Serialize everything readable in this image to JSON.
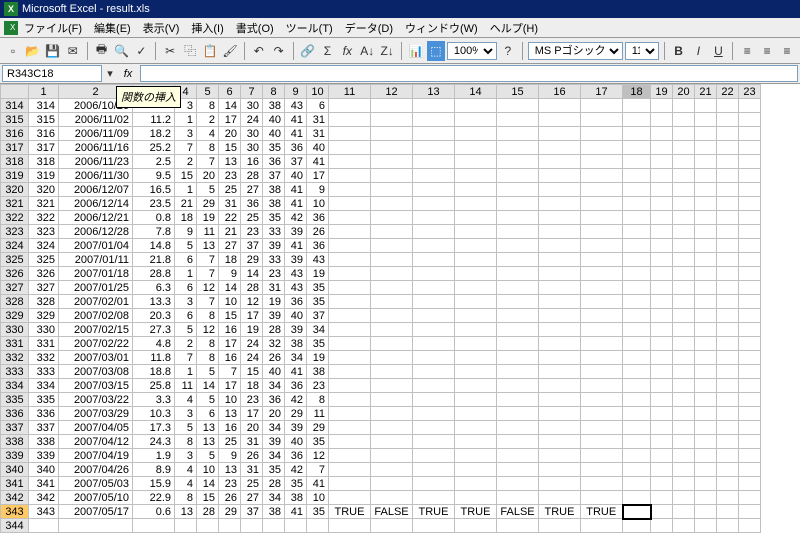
{
  "title": "Microsoft Excel - result.xls",
  "menu": [
    "ファイル(F)",
    "編集(E)",
    "表示(V)",
    "挿入(I)",
    "書式(O)",
    "ツール(T)",
    "データ(D)",
    "ウィンドウ(W)",
    "ヘルプ(H)"
  ],
  "namebox": "R343C18",
  "tooltip": "関数の挿入",
  "zoom": "100%",
  "font": "MS Pゴシック",
  "fontsize": "11",
  "cols": [
    "",
    "1",
    "2",
    "3",
    "4",
    "5",
    "6",
    "7",
    "8",
    "9",
    "10",
    "11",
    "12",
    "13",
    "14",
    "15",
    "16",
    "17",
    "18",
    "19",
    "20",
    "21",
    "22",
    "23"
  ],
  "selcol": "18",
  "selrow": "343",
  "rows": [
    {
      "r": "314",
      "c": [
        "314",
        "2006/10/26",
        "",
        "3",
        "8",
        "14",
        "30",
        "38",
        "43",
        "6",
        "",
        "",
        "",
        "",
        "",
        "",
        "",
        ""
      ]
    },
    {
      "r": "315",
      "c": [
        "315",
        "2006/11/02",
        "11.2",
        "1",
        "2",
        "17",
        "24",
        "40",
        "41",
        "31",
        "",
        "",
        "",
        "",
        "",
        "",
        "",
        ""
      ]
    },
    {
      "r": "316",
      "c": [
        "316",
        "2006/11/09",
        "18.2",
        "3",
        "4",
        "20",
        "30",
        "40",
        "41",
        "31",
        "",
        "",
        "",
        "",
        "",
        "",
        "",
        ""
      ]
    },
    {
      "r": "317",
      "c": [
        "317",
        "2006/11/16",
        "25.2",
        "7",
        "8",
        "15",
        "30",
        "35",
        "36",
        "40",
        "",
        "",
        "",
        "",
        "",
        "",
        "",
        ""
      ]
    },
    {
      "r": "318",
      "c": [
        "318",
        "2006/11/23",
        "2.5",
        "2",
        "7",
        "13",
        "16",
        "36",
        "37",
        "41",
        "",
        "",
        "",
        "",
        "",
        "",
        "",
        ""
      ]
    },
    {
      "r": "319",
      "c": [
        "319",
        "2006/11/30",
        "9.5",
        "15",
        "20",
        "23",
        "28",
        "37",
        "40",
        "17",
        "",
        "",
        "",
        "",
        "",
        "",
        "",
        ""
      ]
    },
    {
      "r": "320",
      "c": [
        "320",
        "2006/12/07",
        "16.5",
        "1",
        "5",
        "25",
        "27",
        "38",
        "41",
        "9",
        "",
        "",
        "",
        "",
        "",
        "",
        "",
        ""
      ]
    },
    {
      "r": "321",
      "c": [
        "321",
        "2006/12/14",
        "23.5",
        "21",
        "29",
        "31",
        "36",
        "38",
        "41",
        "10",
        "",
        "",
        "",
        "",
        "",
        "",
        "",
        ""
      ]
    },
    {
      "r": "322",
      "c": [
        "322",
        "2006/12/21",
        "0.8",
        "18",
        "19",
        "22",
        "25",
        "35",
        "42",
        "36",
        "",
        "",
        "",
        "",
        "",
        "",
        "",
        ""
      ]
    },
    {
      "r": "323",
      "c": [
        "323",
        "2006/12/28",
        "7.8",
        "9",
        "11",
        "21",
        "23",
        "33",
        "39",
        "26",
        "",
        "",
        "",
        "",
        "",
        "",
        "",
        ""
      ]
    },
    {
      "r": "324",
      "c": [
        "324",
        "2007/01/04",
        "14.8",
        "5",
        "13",
        "27",
        "37",
        "39",
        "41",
        "36",
        "",
        "",
        "",
        "",
        "",
        "",
        "",
        ""
      ]
    },
    {
      "r": "325",
      "c": [
        "325",
        "2007/01/11",
        "21.8",
        "6",
        "7",
        "18",
        "29",
        "33",
        "39",
        "43",
        "",
        "",
        "",
        "",
        "",
        "",
        "",
        ""
      ]
    },
    {
      "r": "326",
      "c": [
        "326",
        "2007/01/18",
        "28.8",
        "1",
        "7",
        "9",
        "14",
        "23",
        "43",
        "19",
        "",
        "",
        "",
        "",
        "",
        "",
        "",
        ""
      ]
    },
    {
      "r": "327",
      "c": [
        "327",
        "2007/01/25",
        "6.3",
        "6",
        "12",
        "14",
        "28",
        "31",
        "43",
        "35",
        "",
        "",
        "",
        "",
        "",
        "",
        "",
        ""
      ]
    },
    {
      "r": "328",
      "c": [
        "328",
        "2007/02/01",
        "13.3",
        "3",
        "7",
        "10",
        "12",
        "19",
        "36",
        "35",
        "",
        "",
        "",
        "",
        "",
        "",
        "",
        ""
      ]
    },
    {
      "r": "329",
      "c": [
        "329",
        "2007/02/08",
        "20.3",
        "6",
        "8",
        "15",
        "17",
        "39",
        "40",
        "37",
        "",
        "",
        "",
        "",
        "",
        "",
        "",
        ""
      ]
    },
    {
      "r": "330",
      "c": [
        "330",
        "2007/02/15",
        "27.3",
        "5",
        "12",
        "16",
        "19",
        "28",
        "39",
        "34",
        "",
        "",
        "",
        "",
        "",
        "",
        "",
        ""
      ]
    },
    {
      "r": "331",
      "c": [
        "331",
        "2007/02/22",
        "4.8",
        "2",
        "8",
        "17",
        "24",
        "32",
        "38",
        "35",
        "",
        "",
        "",
        "",
        "",
        "",
        "",
        ""
      ]
    },
    {
      "r": "332",
      "c": [
        "332",
        "2007/03/01",
        "11.8",
        "7",
        "8",
        "16",
        "24",
        "26",
        "34",
        "19",
        "",
        "",
        "",
        "",
        "",
        "",
        "",
        ""
      ]
    },
    {
      "r": "333",
      "c": [
        "333",
        "2007/03/08",
        "18.8",
        "1",
        "5",
        "7",
        "15",
        "40",
        "41",
        "38",
        "",
        "",
        "",
        "",
        "",
        "",
        "",
        ""
      ]
    },
    {
      "r": "334",
      "c": [
        "334",
        "2007/03/15",
        "25.8",
        "11",
        "14",
        "17",
        "18",
        "34",
        "36",
        "23",
        "",
        "",
        "",
        "",
        "",
        "",
        "",
        ""
      ]
    },
    {
      "r": "335",
      "c": [
        "335",
        "2007/03/22",
        "3.3",
        "4",
        "5",
        "10",
        "23",
        "36",
        "42",
        "8",
        "",
        "",
        "",
        "",
        "",
        "",
        "",
        ""
      ]
    },
    {
      "r": "336",
      "c": [
        "336",
        "2007/03/29",
        "10.3",
        "3",
        "6",
        "13",
        "17",
        "20",
        "29",
        "11",
        "",
        "",
        "",
        "",
        "",
        "",
        "",
        ""
      ]
    },
    {
      "r": "337",
      "c": [
        "337",
        "2007/04/05",
        "17.3",
        "5",
        "13",
        "16",
        "20",
        "34",
        "39",
        "29",
        "",
        "",
        "",
        "",
        "",
        "",
        "",
        ""
      ]
    },
    {
      "r": "338",
      "c": [
        "338",
        "2007/04/12",
        "24.3",
        "8",
        "13",
        "25",
        "31",
        "39",
        "40",
        "35",
        "",
        "",
        "",
        "",
        "",
        "",
        "",
        ""
      ]
    },
    {
      "r": "339",
      "c": [
        "339",
        "2007/04/19",
        "1.9",
        "3",
        "5",
        "9",
        "26",
        "34",
        "36",
        "12",
        "",
        "",
        "",
        "",
        "",
        "",
        "",
        ""
      ]
    },
    {
      "r": "340",
      "c": [
        "340",
        "2007/04/26",
        "8.9",
        "4",
        "10",
        "13",
        "31",
        "35",
        "42",
        "7",
        "",
        "",
        "",
        "",
        "",
        "",
        "",
        ""
      ]
    },
    {
      "r": "341",
      "c": [
        "341",
        "2007/05/03",
        "15.9",
        "4",
        "14",
        "23",
        "25",
        "28",
        "35",
        "41",
        "",
        "",
        "",
        "",
        "",
        "",
        "",
        ""
      ]
    },
    {
      "r": "342",
      "c": [
        "342",
        "2007/05/10",
        "22.9",
        "8",
        "15",
        "26",
        "27",
        "34",
        "38",
        "10",
        "",
        "",
        "",
        "",
        "",
        "",
        "",
        ""
      ]
    },
    {
      "r": "343",
      "c": [
        "343",
        "2007/05/17",
        "0.6",
        "13",
        "28",
        "29",
        "37",
        "38",
        "41",
        "35",
        "TRUE",
        "FALSE",
        "TRUE",
        "TRUE",
        "FALSE",
        "TRUE",
        "TRUE",
        ""
      ]
    },
    {
      "r": "344",
      "c": [
        "",
        "",
        "",
        "",
        "",
        "",
        "",
        "",
        "",
        "",
        "",
        "",
        "",
        "",
        "",
        "",
        "",
        ""
      ]
    }
  ]
}
